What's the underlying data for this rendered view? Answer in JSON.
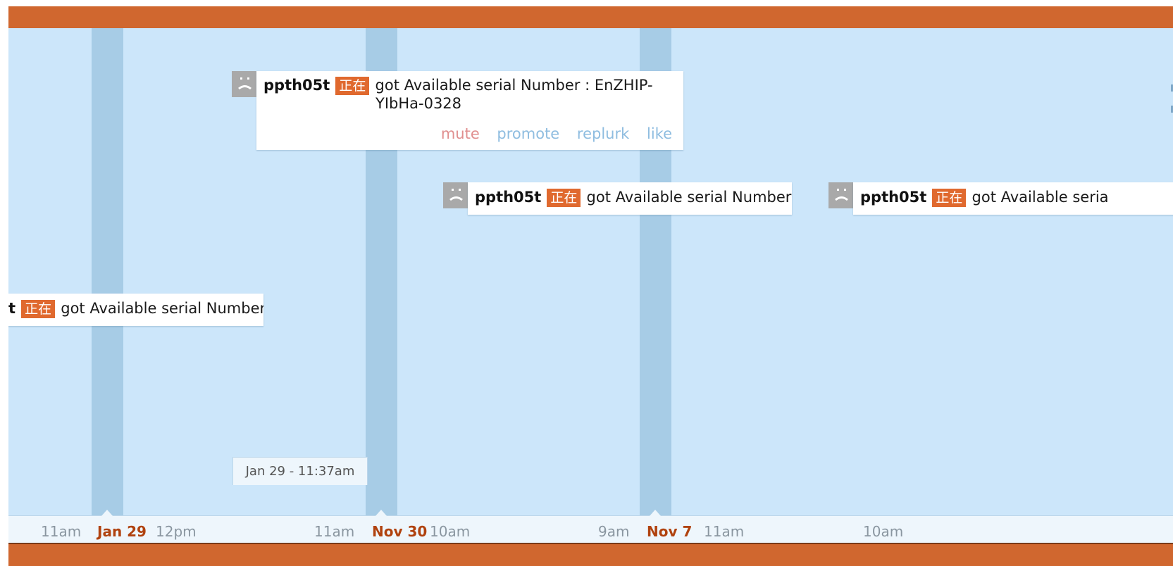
{
  "plurks": [
    {
      "username": "ppth05t",
      "qualifier": "正在",
      "message_line1": "got Available serial Number : EnZHIP-",
      "message_line2": "YIbHa-0328",
      "actions": {
        "mute": "mute",
        "promote": "promote",
        "replurk": "replurk",
        "like": "like"
      }
    },
    {
      "username": "ppth05t",
      "qualifier": "正在",
      "message": "got Available serial Number"
    },
    {
      "username": "ppth05t",
      "qualifier": "正在",
      "message": "got Available seria"
    },
    {
      "username_fragment": "t",
      "qualifier": "正在",
      "message": "got Available serial Number"
    }
  ],
  "tooltip": {
    "text": "Jan 29 - 11:37am"
  },
  "time_labels": {
    "t1": "11am",
    "d1": "Jan 29",
    "t2": "12pm",
    "t3": "11am",
    "d2": "Nov 30",
    "t4": "10am",
    "t5": "9am",
    "d3": "Nov 7",
    "t6": "11am",
    "t7": "10am"
  },
  "colors": {
    "header": "#d0672f",
    "timeline_bg": "#cce6fa",
    "day_column": "#a7cce6",
    "date_label": "#b0420f",
    "qualifier_bg": "#e0692e"
  }
}
